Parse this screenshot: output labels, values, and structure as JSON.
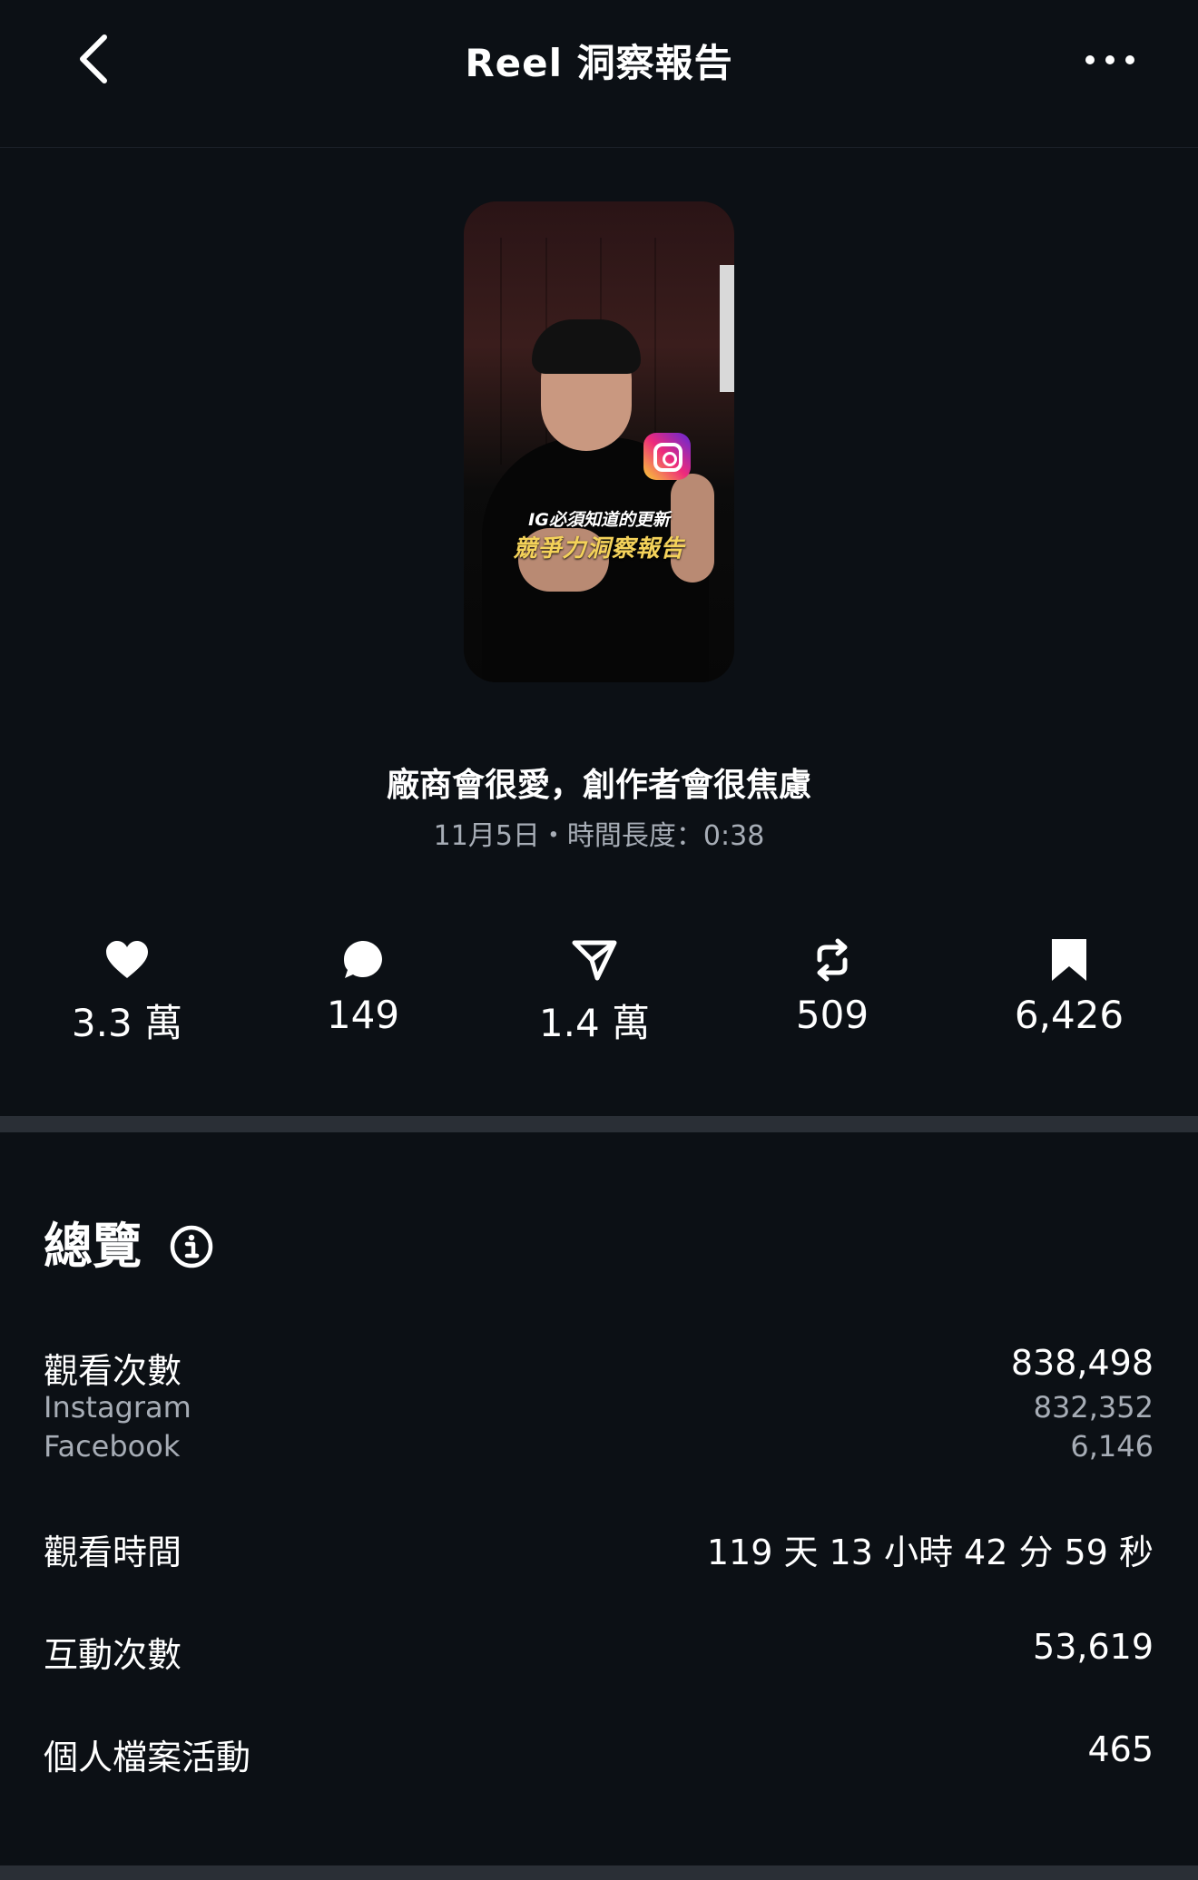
{
  "header": {
    "title": "Reel 洞察報告",
    "back_icon": "chevron-left-icon",
    "more_icon": "more-horizontal-icon"
  },
  "thumbnail": {
    "caption_line1": "IG必須知道的更新",
    "caption_line2": "競爭力洞察報告"
  },
  "reel": {
    "title": "廠商會很愛，創作者會很焦慮",
    "meta": "11月5日・時間長度：0:38"
  },
  "stats": [
    {
      "icon": "heart-icon",
      "value": "3.3 萬"
    },
    {
      "icon": "comment-icon",
      "value": "149"
    },
    {
      "icon": "share-icon",
      "value": "1.4 萬"
    },
    {
      "icon": "repost-icon",
      "value": "509"
    },
    {
      "icon": "bookmark-icon",
      "value": "6,426"
    }
  ],
  "overview": {
    "title": "總覽",
    "info_icon": "info-icon",
    "views": {
      "label": "觀看次數",
      "value": "838,498",
      "breakdown": [
        {
          "label": "Instagram",
          "value": "832,352"
        },
        {
          "label": "Facebook",
          "value": "6,146"
        }
      ]
    },
    "watch_time": {
      "label": "觀看時間",
      "value": "119 天 13 小時 42 分 59 秒"
    },
    "interactions": {
      "label": "互動次數",
      "value": "53,619"
    },
    "profile_activity": {
      "label": "個人檔案活動",
      "value": "465"
    }
  },
  "colors": {
    "background": "#0c1015",
    "secondary_text": "#a7adb6",
    "divider": "#2a2f36",
    "caption_yellow": "#f4d25a"
  }
}
